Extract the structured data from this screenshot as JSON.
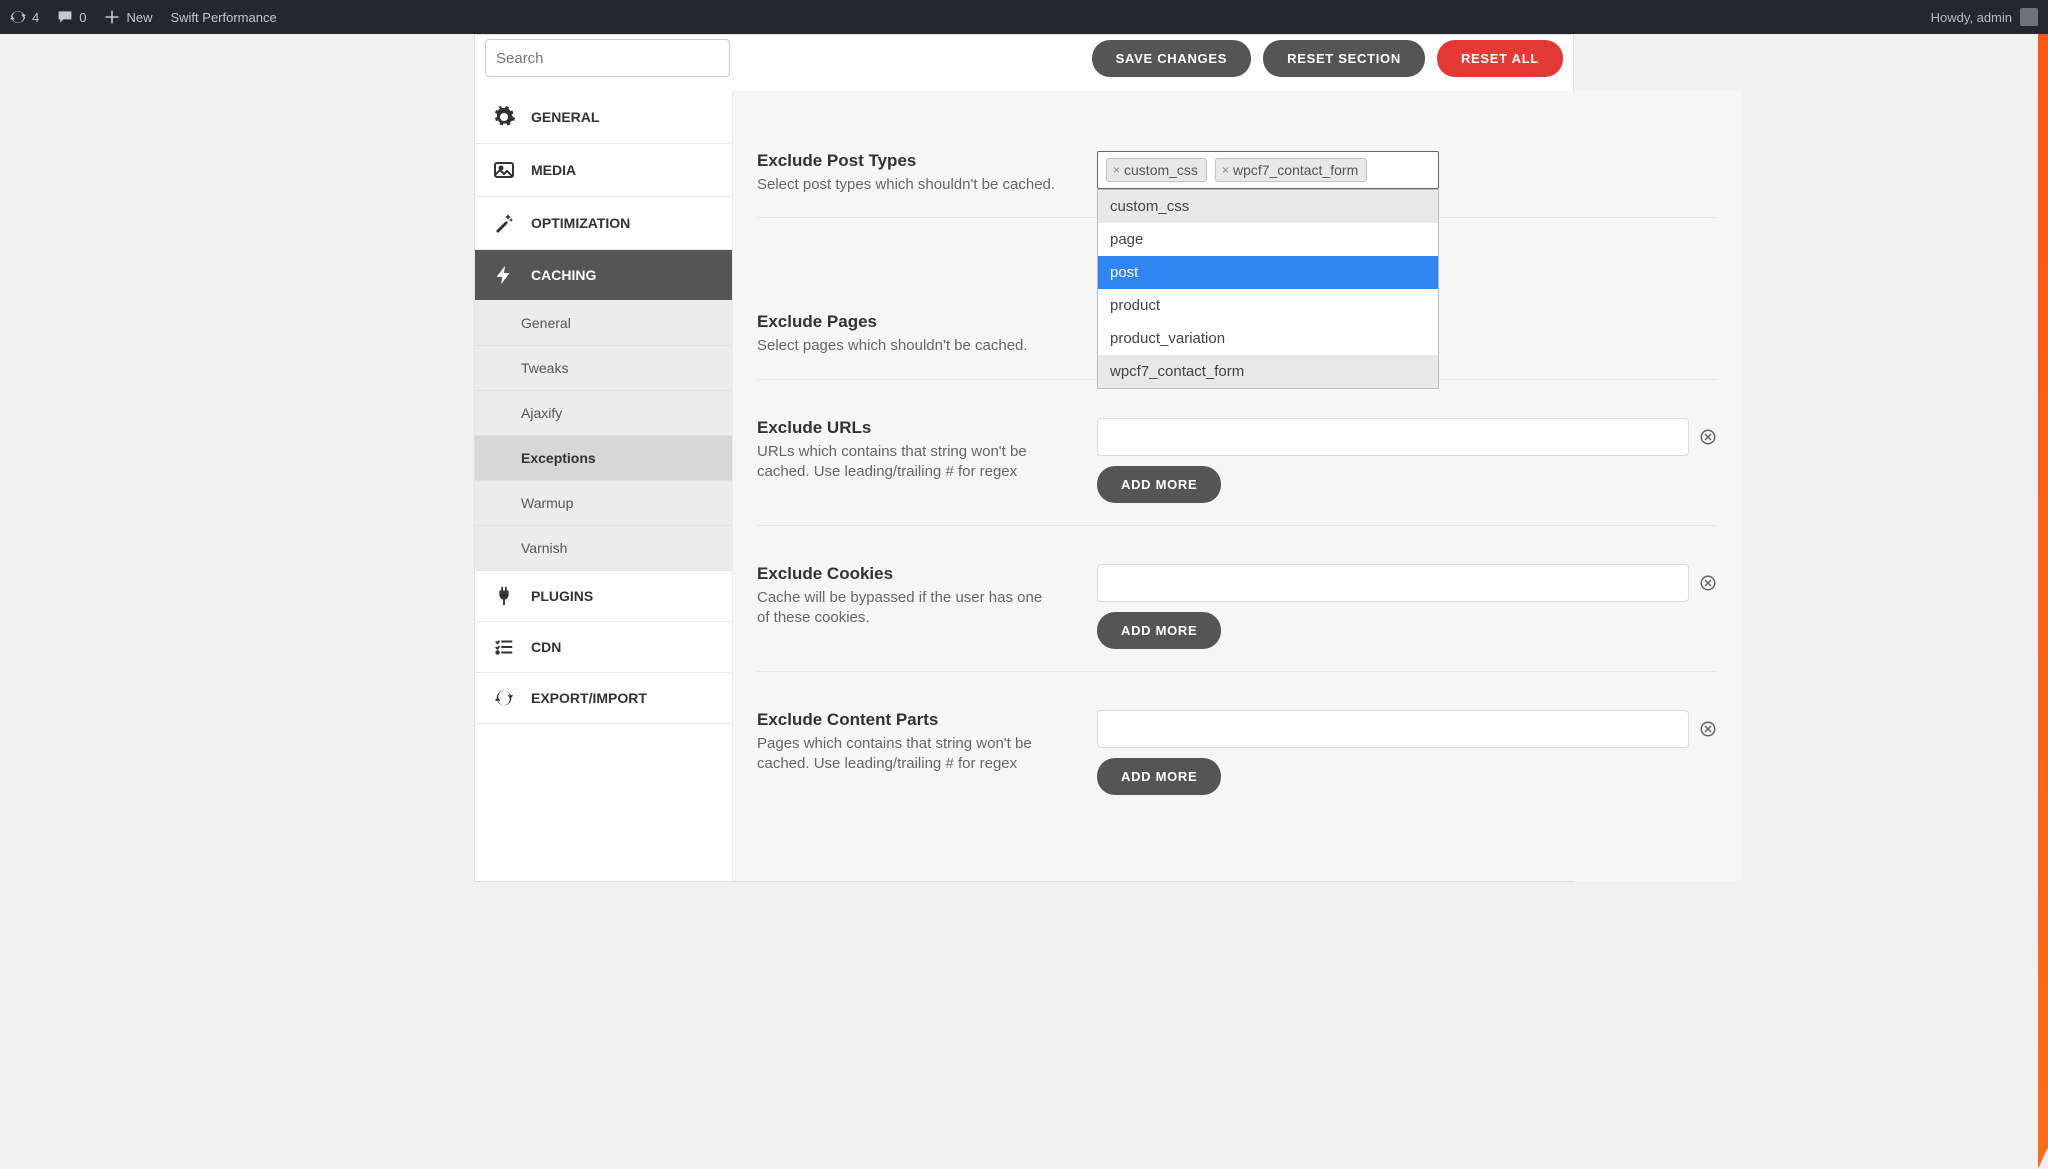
{
  "topbar": {
    "updates_count": "4",
    "comments_count": "0",
    "new_label": "New",
    "app_name": "Swift Performance",
    "howdy": "Howdy, admin"
  },
  "toolbar": {
    "search_placeholder": "Search",
    "save_label": "Save Changes",
    "reset_section_label": "Reset Section",
    "reset_all_label": "Reset All"
  },
  "sidebar": {
    "items": [
      {
        "label": "General",
        "icon": "gear"
      },
      {
        "label": "Media",
        "icon": "image"
      },
      {
        "label": "Optimization",
        "icon": "wand"
      },
      {
        "label": "Caching",
        "icon": "bolt",
        "active": true,
        "children": [
          {
            "label": "General"
          },
          {
            "label": "Tweaks"
          },
          {
            "label": "Ajaxify"
          },
          {
            "label": "Exceptions",
            "active": true
          },
          {
            "label": "Warmup"
          },
          {
            "label": "Varnish"
          }
        ]
      },
      {
        "label": "Plugins",
        "icon": "plug"
      },
      {
        "label": "CDN",
        "icon": "list"
      },
      {
        "label": "Export/Import",
        "icon": "refresh"
      }
    ]
  },
  "fields": {
    "exclude_post_types": {
      "title": "Exclude Post Types",
      "desc": "Select post types which shouldn't be cached.",
      "tags": [
        "custom_css",
        "wpcf7_contact_form"
      ],
      "options": [
        {
          "label": "custom_css",
          "state": "selected"
        },
        {
          "label": "page",
          "state": ""
        },
        {
          "label": "post",
          "state": "highlight"
        },
        {
          "label": "product",
          "state": ""
        },
        {
          "label": "product_variation",
          "state": ""
        },
        {
          "label": "wpcf7_contact_form",
          "state": "selected"
        }
      ]
    },
    "exclude_pages": {
      "title": "Exclude Pages",
      "desc": "Select pages which shouldn't be cached."
    },
    "exclude_urls": {
      "title": "Exclude URLs",
      "desc": "URLs which contains that string won't be cached. Use leading/trailing # for regex",
      "add_more": "Add More"
    },
    "exclude_cookies": {
      "title": "Exclude Cookies",
      "desc": "Cache will be bypassed if the user has one of these cookies.",
      "add_more": "Add More"
    },
    "exclude_content_parts": {
      "title": "Exclude Content Parts",
      "desc": "Pages which contains that string won't be cached. Use leading/trailing # for regex",
      "add_more": "Add More"
    }
  }
}
